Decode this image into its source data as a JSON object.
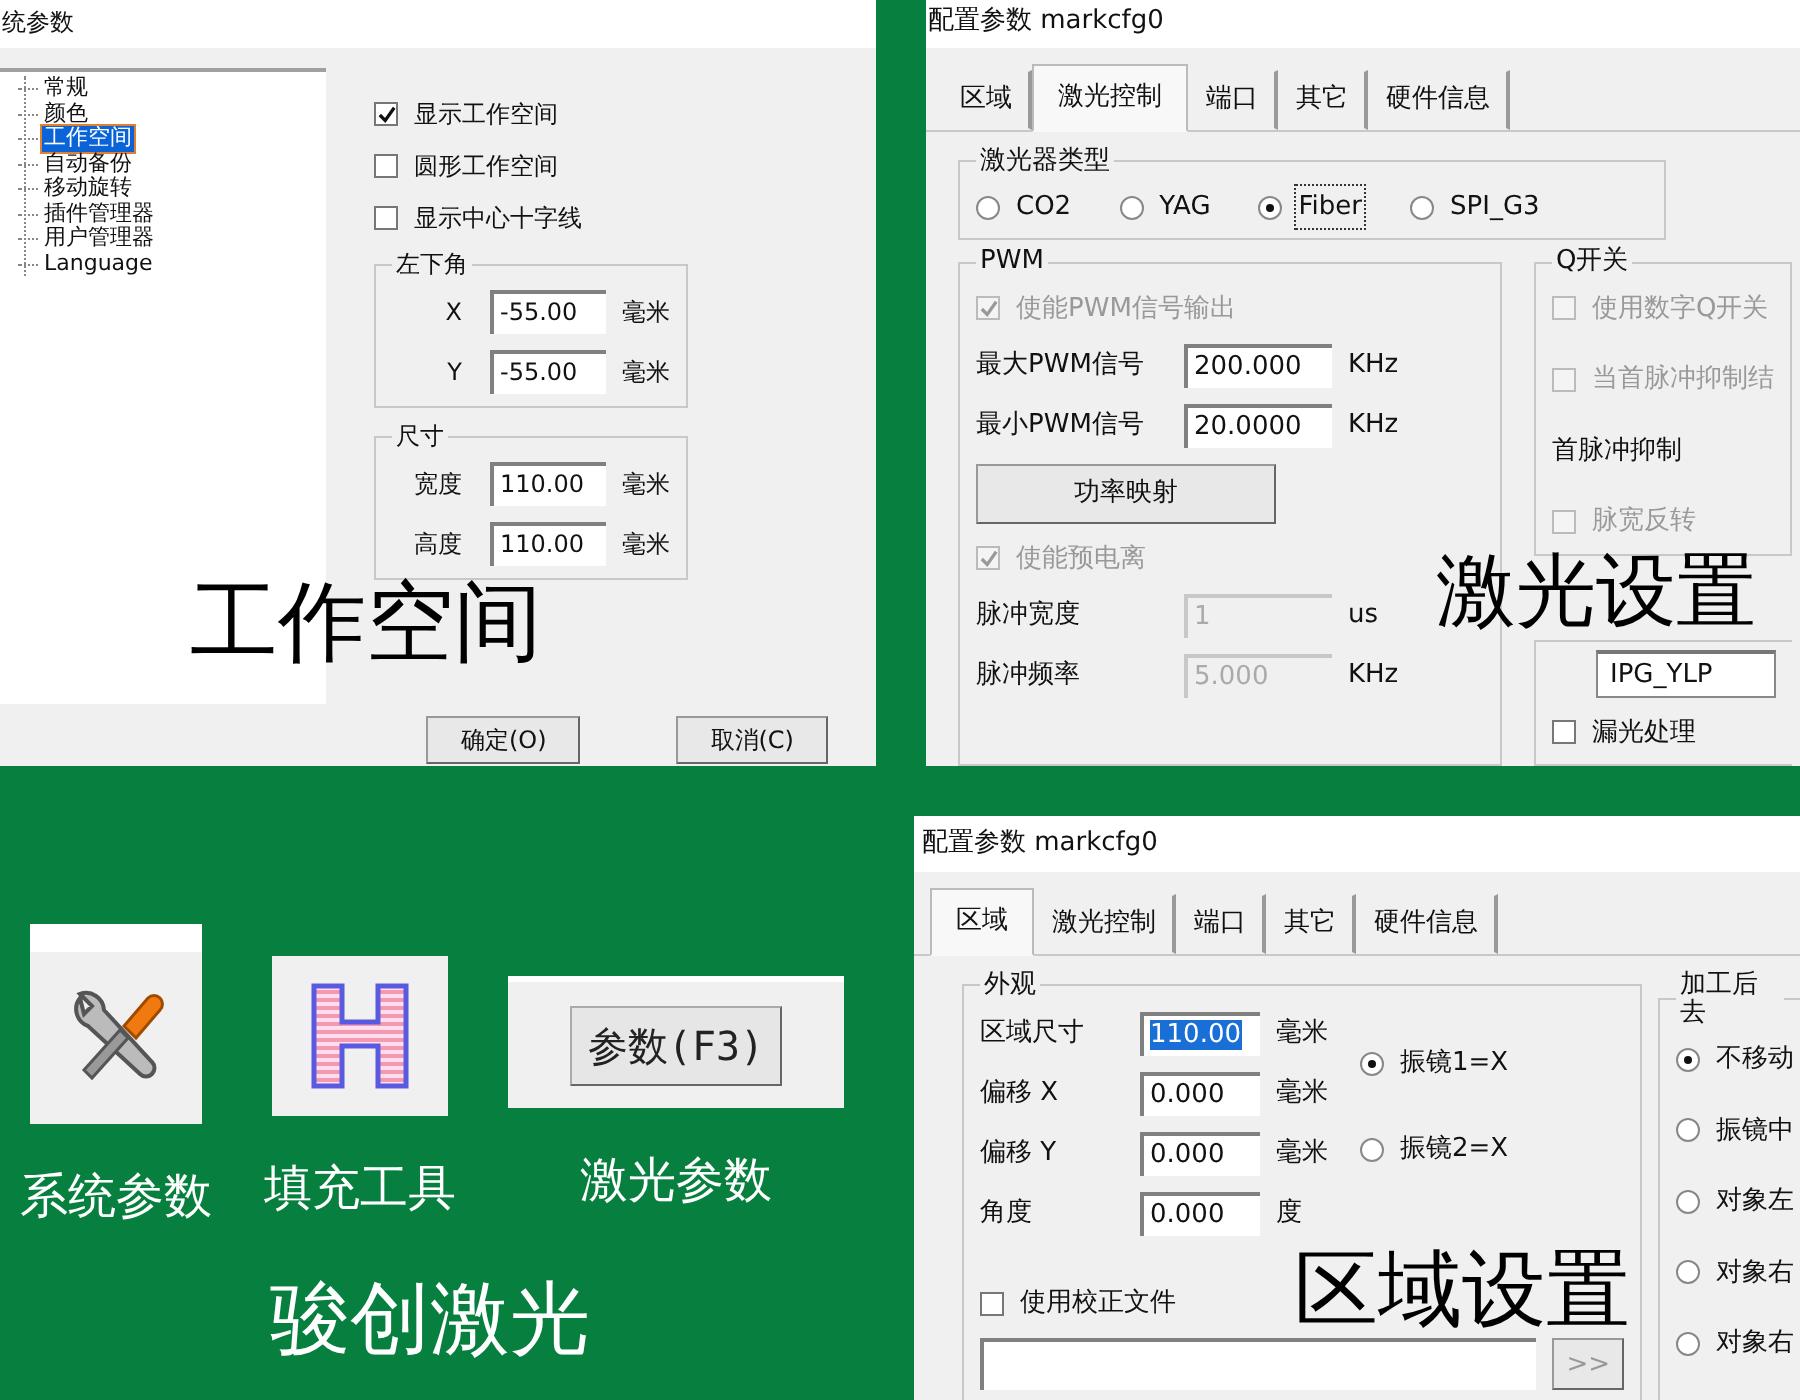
{
  "system_dialog": {
    "title": "统参数",
    "tree": [
      {
        "label": "常规",
        "selected": false
      },
      {
        "label": "颜色",
        "selected": false
      },
      {
        "label": "工作空间",
        "selected": true
      },
      {
        "label": "自动备份",
        "selected": false
      },
      {
        "label": "移动旋转",
        "selected": false
      },
      {
        "label": "插件管理器",
        "selected": false
      },
      {
        "label": "用户管理器",
        "selected": false
      },
      {
        "label": "Language",
        "selected": false
      }
    ],
    "options": [
      {
        "label": "显示工作空间",
        "checked": true
      },
      {
        "label": "圆形工作空间",
        "checked": false
      },
      {
        "label": "显示中心十字线",
        "checked": false
      }
    ],
    "groups": [
      {
        "title": "左下角",
        "rows": [
          {
            "kind": "field",
            "label": "X",
            "value": "-55.00",
            "unit": "毫米"
          },
          {
            "kind": "field",
            "label": "Y",
            "value": "-55.00",
            "unit": "毫米"
          }
        ]
      },
      {
        "title": "尺寸",
        "rows": [
          {
            "kind": "field",
            "label": "宽度",
            "value": "110.00",
            "unit": "毫米"
          },
          {
            "kind": "field",
            "label": "高度",
            "value": "110.00",
            "unit": "毫米"
          }
        ]
      }
    ],
    "buttons": [
      "确定(O)",
      "取消(C)"
    ],
    "caption": "工作空间"
  },
  "laser_dialog": {
    "title": "配置参数 markcfg0",
    "tabs": [
      {
        "label": "区域",
        "selected": false
      },
      {
        "label": "激光控制",
        "selected": true
      },
      {
        "label": "端口",
        "selected": false
      },
      {
        "label": "其它",
        "selected": false
      },
      {
        "label": "硬件信息",
        "selected": false
      }
    ],
    "laser_type": {
      "title": "激光器类型",
      "options": [
        {
          "label": "CO2",
          "selected": false
        },
        {
          "label": "YAG",
          "selected": false
        },
        {
          "label": "Fiber",
          "selected": true
        },
        {
          "label": "SPI_G3",
          "selected": false
        }
      ]
    },
    "pwm": {
      "title": "PWM",
      "rows": [
        {
          "kind": "check",
          "label": "使能PWM信号输出",
          "checked": true,
          "disabled": true
        },
        {
          "kind": "field",
          "label": "最大PWM信号",
          "value": "200.000",
          "unit": "KHz",
          "disabled": false
        },
        {
          "kind": "field",
          "label": "最小PWM信号",
          "value": "20.0000",
          "unit": "KHz",
          "disabled": false
        },
        {
          "kind": "button",
          "label": "功率映射"
        },
        {
          "kind": "check",
          "label": "使能预电离",
          "checked": true,
          "disabled": true
        },
        {
          "kind": "field",
          "label": "脉冲宽度",
          "value": "1",
          "unit": "us",
          "disabled": true
        },
        {
          "kind": "field",
          "label": "脉冲频率",
          "value": "5.000",
          "unit": "KHz",
          "disabled": true
        }
      ]
    },
    "q_switch": {
      "title": "Q开关",
      "rows": [
        {
          "kind": "check",
          "label": "使用数字Q开关",
          "checked": false,
          "disabled": true
        },
        {
          "kind": "check",
          "label": "当首脉冲抑制结",
          "checked": false,
          "disabled": true
        },
        {
          "kind": "heading",
          "label": "首脉冲抑制"
        },
        {
          "kind": "check",
          "label": "脉宽反转",
          "checked": false,
          "disabled": true
        }
      ]
    },
    "fiber": {
      "rows": [
        {
          "kind": "select",
          "value": "IPG_YLP"
        },
        {
          "kind": "check",
          "label": "漏光处理",
          "checked": false,
          "disabled": false
        }
      ]
    },
    "caption": "激光设置"
  },
  "tools": [
    {
      "kind": "wrench",
      "label": "系统参数"
    },
    {
      "kind": "hatch",
      "label": "填充工具"
    },
    {
      "kind": "button",
      "button": "参数(F3)",
      "label": "激光参数"
    }
  ],
  "brand": "骏创激光",
  "area_dialog": {
    "title": "配置参数 markcfg0",
    "tabs": [
      {
        "label": "区域",
        "selected": true
      },
      {
        "label": "激光控制",
        "selected": false
      },
      {
        "label": "端口",
        "selected": false
      },
      {
        "label": "其它",
        "selected": false
      },
      {
        "label": "硬件信息",
        "selected": false
      }
    ],
    "appearance": {
      "title": "外观",
      "rows": [
        {
          "kind": "field",
          "label": "区域尺寸",
          "value": "110.00",
          "unit": "毫米",
          "highlighted": true
        },
        {
          "kind": "field",
          "label": "偏移 X",
          "value": "0.000",
          "unit": "毫米",
          "highlighted": false
        },
        {
          "kind": "field",
          "label": "偏移 Y",
          "value": "0.000",
          "unit": "毫米",
          "highlighted": false
        },
        {
          "kind": "field",
          "label": "角度",
          "value": "0.000",
          "unit": "度",
          "highlighted": false
        }
      ],
      "galvo": [
        {
          "label": "振镜1=X",
          "selected": true
        },
        {
          "label": "振镜2=X",
          "selected": false
        }
      ]
    },
    "calibration": {
      "label": "使用校正文件",
      "checked": false
    },
    "browse_button": ">>",
    "after_group": {
      "title": "加工后去",
      "options": [
        {
          "label": "不移动",
          "selected": true
        },
        {
          "label": "振镜中",
          "selected": false
        },
        {
          "label": "对象左",
          "selected": false
        },
        {
          "label": "对象右",
          "selected": false
        },
        {
          "label": "对象右",
          "selected": false
        }
      ]
    },
    "caption": "区域设置"
  }
}
